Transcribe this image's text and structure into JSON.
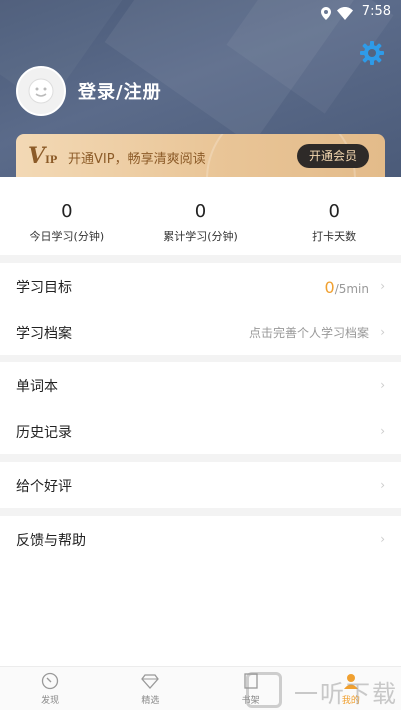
{
  "status": {
    "time": "7:58"
  },
  "header": {
    "login_label": "登录/注册"
  },
  "vip": {
    "logo": "V",
    "logo_sub": "IP",
    "text": "开通VIP，畅享清爽阅读",
    "button": "开通会员"
  },
  "stats": [
    {
      "value": "0",
      "label": "今日学习(分钟)"
    },
    {
      "value": "0",
      "label": "累计学习(分钟)"
    },
    {
      "value": "0",
      "label": "打卡天数"
    }
  ],
  "menu": {
    "goal": {
      "label": "学习目标",
      "value": "0",
      "unit": "/5min"
    },
    "archive": {
      "label": "学习档案",
      "hint": "点击完善个人学习档案"
    },
    "wordbook": {
      "label": "单词本"
    },
    "history": {
      "label": "历史记录"
    },
    "rate": {
      "label": "给个好评"
    },
    "feedback": {
      "label": "反馈与帮助"
    }
  },
  "tabs": [
    {
      "label": "发现",
      "icon": "discover-icon"
    },
    {
      "label": "精选",
      "icon": "diamond-icon"
    },
    {
      "label": "书架",
      "icon": "bookshelf-icon"
    },
    {
      "label": "我的",
      "icon": "profile-icon"
    }
  ],
  "watermark": {
    "text": "一听下载"
  },
  "colors": {
    "accent": "#f0a030",
    "header": "#4f5f7e",
    "vip_gold": "#e9c597"
  }
}
